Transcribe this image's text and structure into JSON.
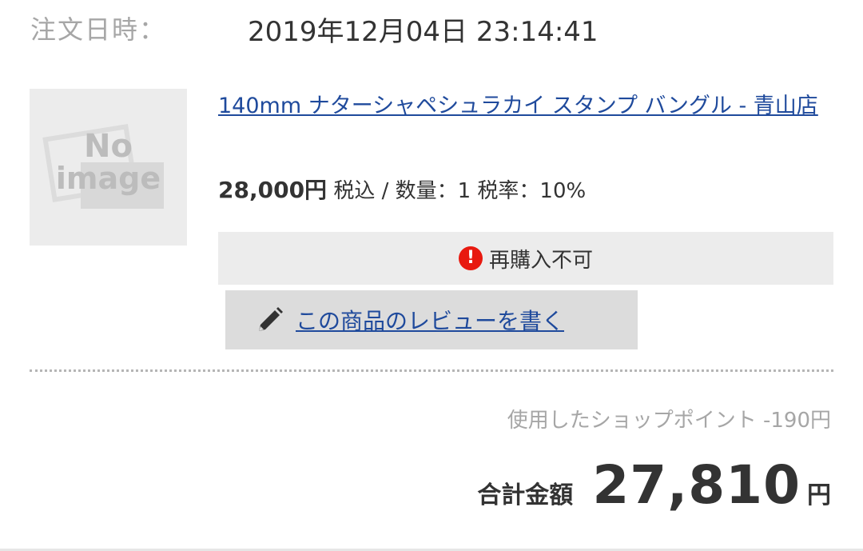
{
  "order": {
    "datetime_label": "注文日時：",
    "datetime_value": "2019年12月04日 23:14:41"
  },
  "item": {
    "image_placeholder": {
      "line1": "No",
      "line2": "image"
    },
    "title": "140mm ナターシャペシュラカイ スタンプ バングル - 青山店",
    "price": "28,000円",
    "price_details": " 税込 / 数量：1 税率：10%",
    "notice": {
      "icon": "alert-icon",
      "text": "再購入不可",
      "icon_color": "#e8190f"
    },
    "review_button": {
      "icon": "pencil-icon",
      "label": "この商品のレビューを書く"
    }
  },
  "summary": {
    "points_used": "使用したショップポイント -190円",
    "total_label": "合計金額",
    "total_amount": "27,810",
    "total_unit": "円"
  },
  "colors": {
    "link": "#1f4a9c",
    "muted": "#a6a6a6",
    "panel": "#ececec"
  }
}
